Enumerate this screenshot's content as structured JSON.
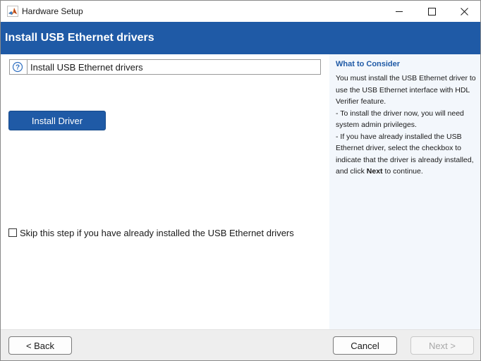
{
  "window": {
    "title": "Hardware Setup",
    "app_icon": "matlab-membrane-icon",
    "controls": {
      "minimize_icon": "minimize-icon",
      "maximize_icon": "maximize-icon",
      "close_icon": "close-icon"
    }
  },
  "header": {
    "title": "Install USB Ethernet drivers",
    "background_color": "#1f5aa6"
  },
  "main": {
    "step_label": "Install USB Ethernet drivers",
    "help_icon": "question-icon",
    "install_button_label": "Install Driver",
    "skip_checkbox": {
      "checked": false,
      "label": "Skip this step if you have already installed the USB Ethernet drivers"
    }
  },
  "info_panel": {
    "heading": "What to Consider",
    "intro": "You must install the USB Ethernet driver to use the USB Ethernet interface with HDL Verifier feature.",
    "bullet_1": " - To install the driver now, you will need system admin privileges.",
    "bullet_2_before": " - If you have already installed the USB Ethernet driver, select the checkbox to indicate that the driver is already installed, and click ",
    "bullet_2_bold": "Next",
    "bullet_2_after": " to continue."
  },
  "footer": {
    "back_label": "< Back",
    "cancel_label": "Cancel",
    "next_label": "Next >",
    "next_enabled": false
  }
}
